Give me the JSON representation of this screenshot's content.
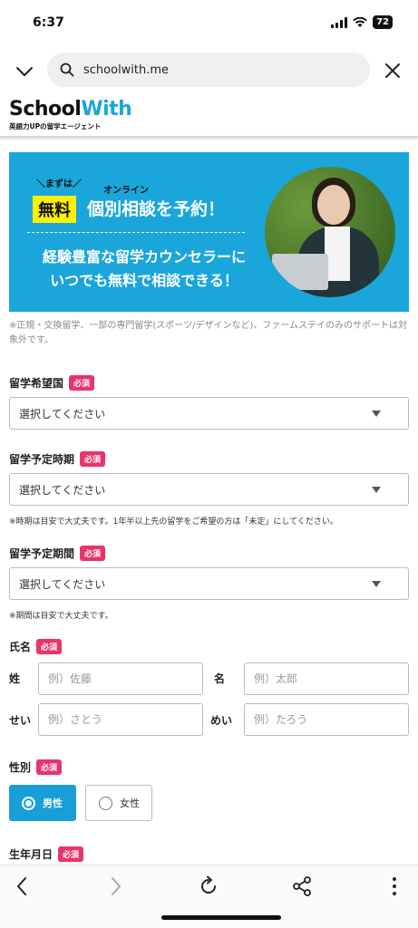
{
  "status": {
    "time": "6:37",
    "battery": "72"
  },
  "browser": {
    "url": "schoolwith.me"
  },
  "site": {
    "logo_school": "School",
    "logo_with": "With",
    "logo_sub": "英語力UPの留学エージェント"
  },
  "banner": {
    "mazuha": "＼まずは／",
    "free": "無料",
    "online": "オンライン",
    "title": "個別相談を予約！",
    "line1": "経験豊富な留学カウンセラーに",
    "line2": "いつでも無料で相談できる！"
  },
  "notice": "※正規・交換留学、一部の専門留学(スポーツ/デザインなど)、ファームステイのみのサポートは対象外です。",
  "required_label": "必須",
  "form": {
    "country": {
      "label": "留学希望国",
      "value": "選択してください"
    },
    "timing": {
      "label": "留学予定時期",
      "value": "選択してください",
      "note": "※時期は目安で大丈夫です。1年半以上先の留学をご希望の方は「未定」にしてください。"
    },
    "period": {
      "label": "留学予定期間",
      "value": "選択してください",
      "note": "※期間は目安で大丈夫です。"
    },
    "name": {
      "label": "氏名",
      "sei_label": "姓",
      "sei_placeholder": "例）佐藤",
      "mei_label": "名",
      "mei_placeholder": "例）太郎",
      "sei_kana_label": "せい",
      "sei_kana_placeholder": "例）さとう",
      "mei_kana_label": "めい",
      "mei_kana_placeholder": "例）たろう"
    },
    "gender": {
      "label": "性別",
      "male": "男性",
      "female": "女性",
      "selected": "男性"
    },
    "birthday": {
      "label": "生年月日"
    }
  },
  "colors": {
    "accent": "#1aa6db",
    "required": "#e8346a",
    "highlight": "#fff200"
  },
  "icons": [
    "chevron-down-icon",
    "search-icon",
    "close-icon",
    "back-icon",
    "forward-icon",
    "reload-icon",
    "share-icon",
    "more-icon"
  ]
}
